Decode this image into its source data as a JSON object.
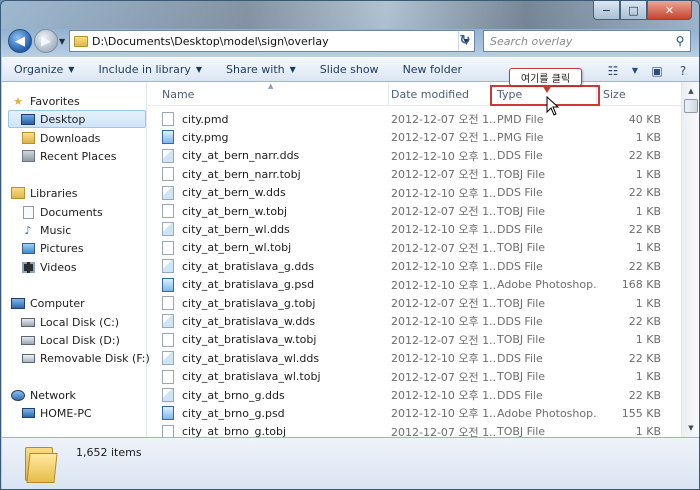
{
  "window": {
    "caption_buttons": {
      "minimize": "−",
      "maximize": "□",
      "close": "✕"
    }
  },
  "nav": {
    "back_glyph": "◀",
    "forward_glyph": "▶",
    "address": "D:\\Documents\\Desktop\\model\\sign\\overlay",
    "search_placeholder": "Search overlay",
    "refresh_glyph": "↻"
  },
  "toolbar": {
    "organize": "Organize",
    "include_in_library": "Include in library",
    "share_with": "Share with",
    "slide_show": "Slide show",
    "new_folder": "New folder"
  },
  "sidebar": {
    "favorites": "Favorites",
    "desktop": "Desktop",
    "downloads": "Downloads",
    "recent_places": "Recent Places",
    "libraries": "Libraries",
    "documents": "Documents",
    "music": "Music",
    "pictures": "Pictures",
    "videos": "Videos",
    "computer": "Computer",
    "local_disk_c": "Local Disk (C:)",
    "local_disk_d": "Local Disk (D:)",
    "removable_disk_f": "Removable Disk (F:)",
    "network": "Network",
    "home_pc": "HOME-PC"
  },
  "columns": {
    "name": "Name",
    "date": "Date modified",
    "type": "Type",
    "size": "Size"
  },
  "files": [
    {
      "name": "city.pmd",
      "date": "2012-12-07 오전 1...",
      "type": "PMD File",
      "size": "40 KB",
      "icon": "file"
    },
    {
      "name": "city.pmg",
      "date": "2012-12-07 오전 1...",
      "type": "PMG File",
      "size": "1 KB",
      "icon": "psd"
    },
    {
      "name": "city_at_bern_narr.dds",
      "date": "2012-12-10 오후 1...",
      "type": "DDS File",
      "size": "22 KB",
      "icon": "dds"
    },
    {
      "name": "city_at_bern_narr.tobj",
      "date": "2012-12-07 오전 1...",
      "type": "TOBJ File",
      "size": "1 KB",
      "icon": "file"
    },
    {
      "name": "city_at_bern_w.dds",
      "date": "2012-12-10 오후 1...",
      "type": "DDS File",
      "size": "22 KB",
      "icon": "dds"
    },
    {
      "name": "city_at_bern_w.tobj",
      "date": "2012-12-07 오전 1...",
      "type": "TOBJ File",
      "size": "1 KB",
      "icon": "file"
    },
    {
      "name": "city_at_bern_wl.dds",
      "date": "2012-12-10 오후 1...",
      "type": "DDS File",
      "size": "22 KB",
      "icon": "dds"
    },
    {
      "name": "city_at_bern_wl.tobj",
      "date": "2012-12-07 오전 1...",
      "type": "TOBJ File",
      "size": "1 KB",
      "icon": "file"
    },
    {
      "name": "city_at_bratislava_g.dds",
      "date": "2012-12-10 오후 1...",
      "type": "DDS File",
      "size": "22 KB",
      "icon": "dds"
    },
    {
      "name": "city_at_bratislava_g.psd",
      "date": "2012-12-10 오후 1...",
      "type": "Adobe Photoshop...",
      "size": "168 KB",
      "icon": "psd"
    },
    {
      "name": "city_at_bratislava_g.tobj",
      "date": "2012-12-07 오전 1...",
      "type": "TOBJ File",
      "size": "1 KB",
      "icon": "file"
    },
    {
      "name": "city_at_bratislava_w.dds",
      "date": "2012-12-10 오후 1...",
      "type": "DDS File",
      "size": "22 KB",
      "icon": "dds"
    },
    {
      "name": "city_at_bratislava_w.tobj",
      "date": "2012-12-07 오전 1...",
      "type": "TOBJ File",
      "size": "1 KB",
      "icon": "file"
    },
    {
      "name": "city_at_bratislava_wl.dds",
      "date": "2012-12-10 오후 1...",
      "type": "DDS File",
      "size": "22 KB",
      "icon": "dds"
    },
    {
      "name": "city_at_bratislava_wl.tobj",
      "date": "2012-12-07 오전 1...",
      "type": "TOBJ File",
      "size": "1 KB",
      "icon": "file"
    },
    {
      "name": "city_at_brno_g.dds",
      "date": "2012-12-10 오후 1...",
      "type": "DDS File",
      "size": "22 KB",
      "icon": "dds"
    },
    {
      "name": "city_at_brno_g.psd",
      "date": "2012-12-10 오후 1...",
      "type": "Adobe Photoshop...",
      "size": "155 KB",
      "icon": "psd"
    },
    {
      "name": "city_at_brno_g.tobj",
      "date": "2012-12-07 오전 1...",
      "type": "TOBJ File",
      "size": "1 KB",
      "icon": "file"
    }
  ],
  "annotation": {
    "callout": "여기를 클릭"
  },
  "details": {
    "item_count": "1,652 items"
  },
  "colors": {
    "highlight": "#d23636",
    "selection": "#cfe4f7",
    "toolbar_text": "#1e395b"
  }
}
